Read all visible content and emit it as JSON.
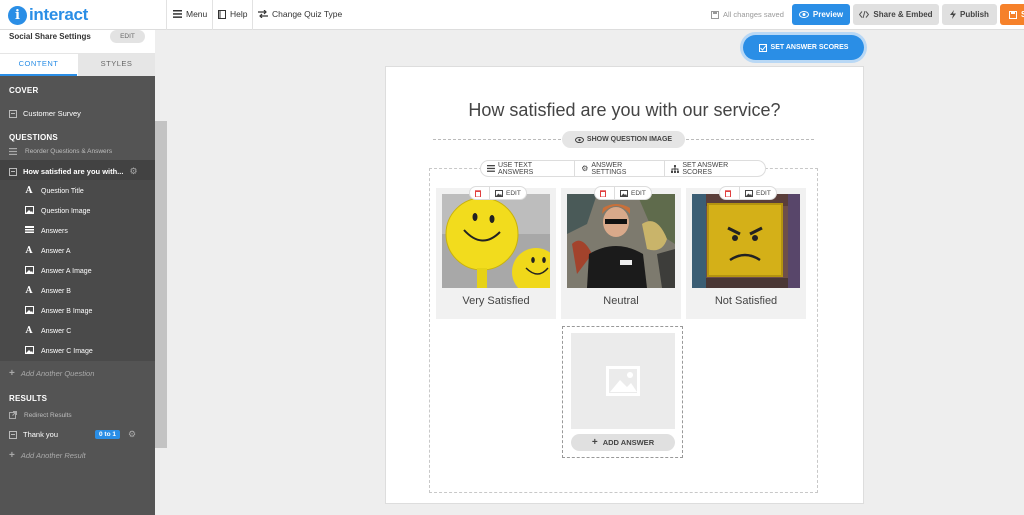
{
  "app": {
    "logo_text": "interact"
  },
  "topbar": {
    "menu_label": "Menu",
    "help_label": "Help",
    "change_quiz_label": "Change Quiz Type",
    "saved_status": "All changes saved",
    "preview_label": "Preview",
    "share_label": "Share & Embed",
    "publish_label": "Publish",
    "save_label": "S"
  },
  "sidebar": {
    "header_title": "Social Share Settings",
    "header_edit": "EDIT",
    "tabs": [
      {
        "label": "CONTENT",
        "active": true
      },
      {
        "label": "STYLES",
        "active": false
      }
    ],
    "cover_heading": "COVER",
    "cover_item": "Customer Survey",
    "questions_heading": "QUESTIONS",
    "reorder_label": "Reorder Questions & Answers",
    "active_question": "How satisfied are you with...",
    "question_sub_items": [
      {
        "label": "Question Title",
        "icon": "text-icon"
      },
      {
        "label": "Question Image",
        "icon": "image-icon"
      },
      {
        "label": "Answers",
        "icon": "list-icon"
      },
      {
        "label": "Answer A",
        "icon": "text-icon"
      },
      {
        "label": "Answer A Image",
        "icon": "image-icon"
      },
      {
        "label": "Answer B",
        "icon": "text-icon"
      },
      {
        "label": "Answer B Image",
        "icon": "image-icon"
      },
      {
        "label": "Answer C",
        "icon": "text-icon"
      },
      {
        "label": "Answer C Image",
        "icon": "image-icon"
      }
    ],
    "add_question": "Add Another Question",
    "results_heading": "RESULTS",
    "redirect_label": "Redirect Results",
    "result_item": "Thank you",
    "result_badge": "0 to 1",
    "add_result": "Add Another Result"
  },
  "editor": {
    "set_scores_top": "SET ANSWER SCORES",
    "question_title": "How satisfied are you with our service?",
    "show_image_label": "SHOW QUESTION IMAGE",
    "answer_toolbar": [
      "USE TEXT ANSWERS",
      "ANSWER SETTINGS",
      "SET ANSWER SCORES"
    ],
    "answers": [
      {
        "label": "Very Satisfied",
        "edit": "EDIT"
      },
      {
        "label": "Neutral",
        "edit": "EDIT"
      },
      {
        "label": "Not Satisfied",
        "edit": "EDIT"
      }
    ],
    "add_answer_label": "ADD ANSWER"
  },
  "colors": {
    "accent": "#2a8ee6",
    "sidebar": "#545454",
    "save": "#f6812a"
  }
}
